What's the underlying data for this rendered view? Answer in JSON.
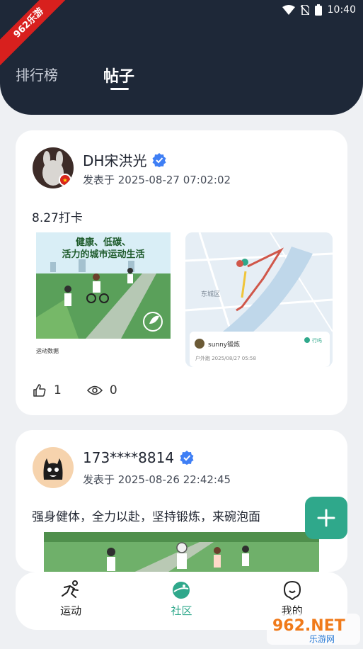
{
  "status": {
    "time": "10:40"
  },
  "ribbon": "962乐游",
  "tabs": [
    {
      "label": "排行榜"
    },
    {
      "label": "帖子"
    }
  ],
  "posts": [
    {
      "username": "DH宋洪光",
      "posted": "发表于 2025-08-27 07:02:02",
      "content": "8.27打卡",
      "image1": {
        "headline1": "健康、低碳、",
        "headline2": "活力的城市运动生活",
        "caption": "运动数据"
      },
      "image2": {
        "district": "东城区",
        "user": "sunny锻炼",
        "badge": "行吗",
        "meta": "户外跑 2025/08/27 05:58"
      },
      "likes": "1",
      "views": "0"
    },
    {
      "username": "173****8814",
      "posted": "发表于 2025-08-26 22:42:45",
      "content": "强身健体，全力以赴，坚持锻炼，来碗泡面"
    }
  ],
  "nav": [
    {
      "label": "运动"
    },
    {
      "label": "社区"
    },
    {
      "label": "我的"
    }
  ],
  "watermark": {
    "brand": "962.NET",
    "sub": "乐游网"
  },
  "colors": {
    "header": "#1e2838",
    "accent": "#2fa88b",
    "background": "#eef0f3"
  }
}
